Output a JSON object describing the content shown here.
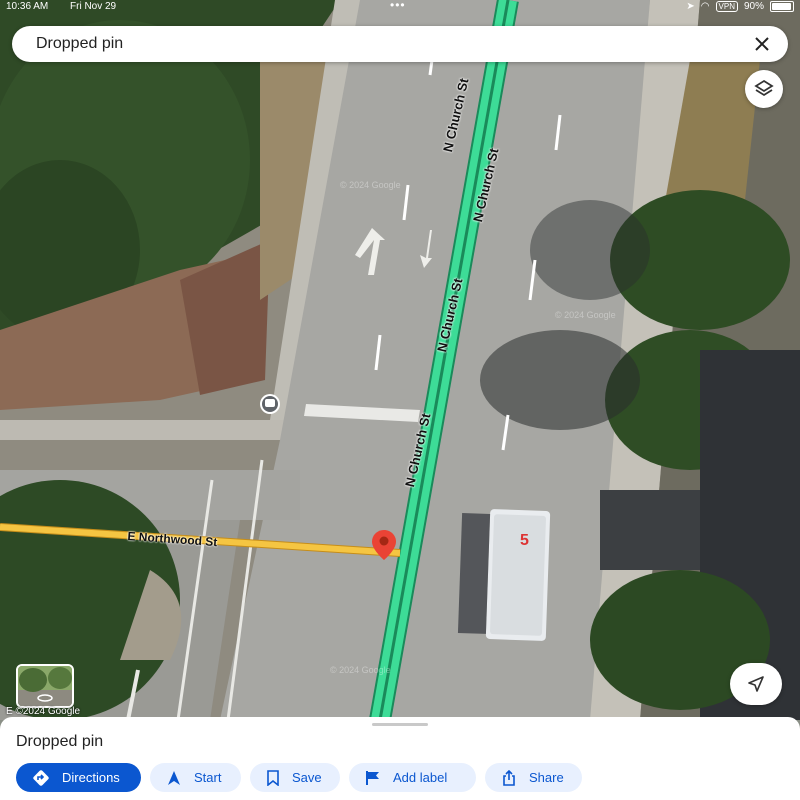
{
  "status_bar": {
    "time": "10:36 AM",
    "date": "Fri Nov 29",
    "vpn": "VPN",
    "battery": "90%"
  },
  "search": {
    "query": "Dropped pin",
    "close_icon": "close-icon"
  },
  "map": {
    "street_labels": [
      "N Church St",
      "N Church St",
      "N Church St",
      "N Church St",
      "E Northwood St"
    ],
    "credit": "E ©2024 Google",
    "watermarks": [
      "© 2024 Google",
      "© 2024 Google",
      "© 2024 Google"
    ],
    "bus_marking": "5",
    "highlight_color": "#3ddc97",
    "street_color": "#f5c542",
    "pin_color": "#ea4335"
  },
  "sheet": {
    "title": "Dropped pin",
    "actions": [
      {
        "label": "Directions",
        "icon": "directions-icon"
      },
      {
        "label": "Start",
        "icon": "navigation-arrow-icon"
      },
      {
        "label": "Save",
        "icon": "bookmark-icon"
      },
      {
        "label": "Add label",
        "icon": "flag-icon"
      },
      {
        "label": "Share",
        "icon": "share-icon"
      }
    ]
  },
  "colors": {
    "accent": "#0b57d0",
    "chip_bg": "#e8f0fe"
  }
}
